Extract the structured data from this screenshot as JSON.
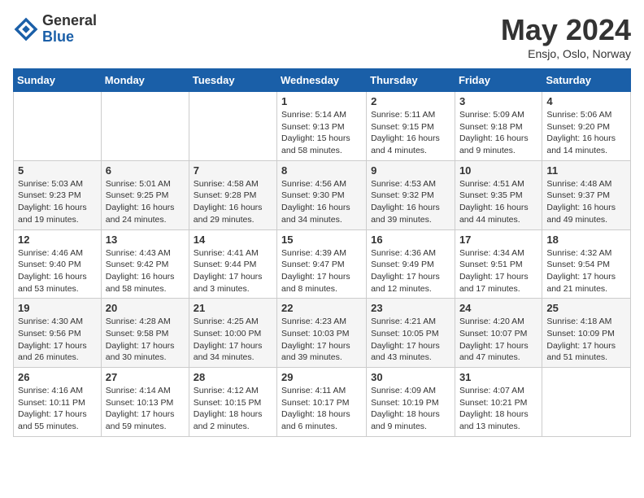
{
  "header": {
    "logo_general": "General",
    "logo_blue": "Blue",
    "month_title": "May 2024",
    "subtitle": "Ensjo, Oslo, Norway"
  },
  "weekdays": [
    "Sunday",
    "Monday",
    "Tuesday",
    "Wednesday",
    "Thursday",
    "Friday",
    "Saturday"
  ],
  "weeks": [
    [
      {
        "day": "",
        "sunrise": "",
        "sunset": "",
        "daylight": ""
      },
      {
        "day": "",
        "sunrise": "",
        "sunset": "",
        "daylight": ""
      },
      {
        "day": "",
        "sunrise": "",
        "sunset": "",
        "daylight": ""
      },
      {
        "day": "1",
        "sunrise": "Sunrise: 5:14 AM",
        "sunset": "Sunset: 9:13 PM",
        "daylight": "Daylight: 15 hours and 58 minutes."
      },
      {
        "day": "2",
        "sunrise": "Sunrise: 5:11 AM",
        "sunset": "Sunset: 9:15 PM",
        "daylight": "Daylight: 16 hours and 4 minutes."
      },
      {
        "day": "3",
        "sunrise": "Sunrise: 5:09 AM",
        "sunset": "Sunset: 9:18 PM",
        "daylight": "Daylight: 16 hours and 9 minutes."
      },
      {
        "day": "4",
        "sunrise": "Sunrise: 5:06 AM",
        "sunset": "Sunset: 9:20 PM",
        "daylight": "Daylight: 16 hours and 14 minutes."
      }
    ],
    [
      {
        "day": "5",
        "sunrise": "Sunrise: 5:03 AM",
        "sunset": "Sunset: 9:23 PM",
        "daylight": "Daylight: 16 hours and 19 minutes."
      },
      {
        "day": "6",
        "sunrise": "Sunrise: 5:01 AM",
        "sunset": "Sunset: 9:25 PM",
        "daylight": "Daylight: 16 hours and 24 minutes."
      },
      {
        "day": "7",
        "sunrise": "Sunrise: 4:58 AM",
        "sunset": "Sunset: 9:28 PM",
        "daylight": "Daylight: 16 hours and 29 minutes."
      },
      {
        "day": "8",
        "sunrise": "Sunrise: 4:56 AM",
        "sunset": "Sunset: 9:30 PM",
        "daylight": "Daylight: 16 hours and 34 minutes."
      },
      {
        "day": "9",
        "sunrise": "Sunrise: 4:53 AM",
        "sunset": "Sunset: 9:32 PM",
        "daylight": "Daylight: 16 hours and 39 minutes."
      },
      {
        "day": "10",
        "sunrise": "Sunrise: 4:51 AM",
        "sunset": "Sunset: 9:35 PM",
        "daylight": "Daylight: 16 hours and 44 minutes."
      },
      {
        "day": "11",
        "sunrise": "Sunrise: 4:48 AM",
        "sunset": "Sunset: 9:37 PM",
        "daylight": "Daylight: 16 hours and 49 minutes."
      }
    ],
    [
      {
        "day": "12",
        "sunrise": "Sunrise: 4:46 AM",
        "sunset": "Sunset: 9:40 PM",
        "daylight": "Daylight: 16 hours and 53 minutes."
      },
      {
        "day": "13",
        "sunrise": "Sunrise: 4:43 AM",
        "sunset": "Sunset: 9:42 PM",
        "daylight": "Daylight: 16 hours and 58 minutes."
      },
      {
        "day": "14",
        "sunrise": "Sunrise: 4:41 AM",
        "sunset": "Sunset: 9:44 PM",
        "daylight": "Daylight: 17 hours and 3 minutes."
      },
      {
        "day": "15",
        "sunrise": "Sunrise: 4:39 AM",
        "sunset": "Sunset: 9:47 PM",
        "daylight": "Daylight: 17 hours and 8 minutes."
      },
      {
        "day": "16",
        "sunrise": "Sunrise: 4:36 AM",
        "sunset": "Sunset: 9:49 PM",
        "daylight": "Daylight: 17 hours and 12 minutes."
      },
      {
        "day": "17",
        "sunrise": "Sunrise: 4:34 AM",
        "sunset": "Sunset: 9:51 PM",
        "daylight": "Daylight: 17 hours and 17 minutes."
      },
      {
        "day": "18",
        "sunrise": "Sunrise: 4:32 AM",
        "sunset": "Sunset: 9:54 PM",
        "daylight": "Daylight: 17 hours and 21 minutes."
      }
    ],
    [
      {
        "day": "19",
        "sunrise": "Sunrise: 4:30 AM",
        "sunset": "Sunset: 9:56 PM",
        "daylight": "Daylight: 17 hours and 26 minutes."
      },
      {
        "day": "20",
        "sunrise": "Sunrise: 4:28 AM",
        "sunset": "Sunset: 9:58 PM",
        "daylight": "Daylight: 17 hours and 30 minutes."
      },
      {
        "day": "21",
        "sunrise": "Sunrise: 4:25 AM",
        "sunset": "Sunset: 10:00 PM",
        "daylight": "Daylight: 17 hours and 34 minutes."
      },
      {
        "day": "22",
        "sunrise": "Sunrise: 4:23 AM",
        "sunset": "Sunset: 10:03 PM",
        "daylight": "Daylight: 17 hours and 39 minutes."
      },
      {
        "day": "23",
        "sunrise": "Sunrise: 4:21 AM",
        "sunset": "Sunset: 10:05 PM",
        "daylight": "Daylight: 17 hours and 43 minutes."
      },
      {
        "day": "24",
        "sunrise": "Sunrise: 4:20 AM",
        "sunset": "Sunset: 10:07 PM",
        "daylight": "Daylight: 17 hours and 47 minutes."
      },
      {
        "day": "25",
        "sunrise": "Sunrise: 4:18 AM",
        "sunset": "Sunset: 10:09 PM",
        "daylight": "Daylight: 17 hours and 51 minutes."
      }
    ],
    [
      {
        "day": "26",
        "sunrise": "Sunrise: 4:16 AM",
        "sunset": "Sunset: 10:11 PM",
        "daylight": "Daylight: 17 hours and 55 minutes."
      },
      {
        "day": "27",
        "sunrise": "Sunrise: 4:14 AM",
        "sunset": "Sunset: 10:13 PM",
        "daylight": "Daylight: 17 hours and 59 minutes."
      },
      {
        "day": "28",
        "sunrise": "Sunrise: 4:12 AM",
        "sunset": "Sunset: 10:15 PM",
        "daylight": "Daylight: 18 hours and 2 minutes."
      },
      {
        "day": "29",
        "sunrise": "Sunrise: 4:11 AM",
        "sunset": "Sunset: 10:17 PM",
        "daylight": "Daylight: 18 hours and 6 minutes."
      },
      {
        "day": "30",
        "sunrise": "Sunrise: 4:09 AM",
        "sunset": "Sunset: 10:19 PM",
        "daylight": "Daylight: 18 hours and 9 minutes."
      },
      {
        "day": "31",
        "sunrise": "Sunrise: 4:07 AM",
        "sunset": "Sunset: 10:21 PM",
        "daylight": "Daylight: 18 hours and 13 minutes."
      },
      {
        "day": "",
        "sunrise": "",
        "sunset": "",
        "daylight": ""
      }
    ]
  ]
}
